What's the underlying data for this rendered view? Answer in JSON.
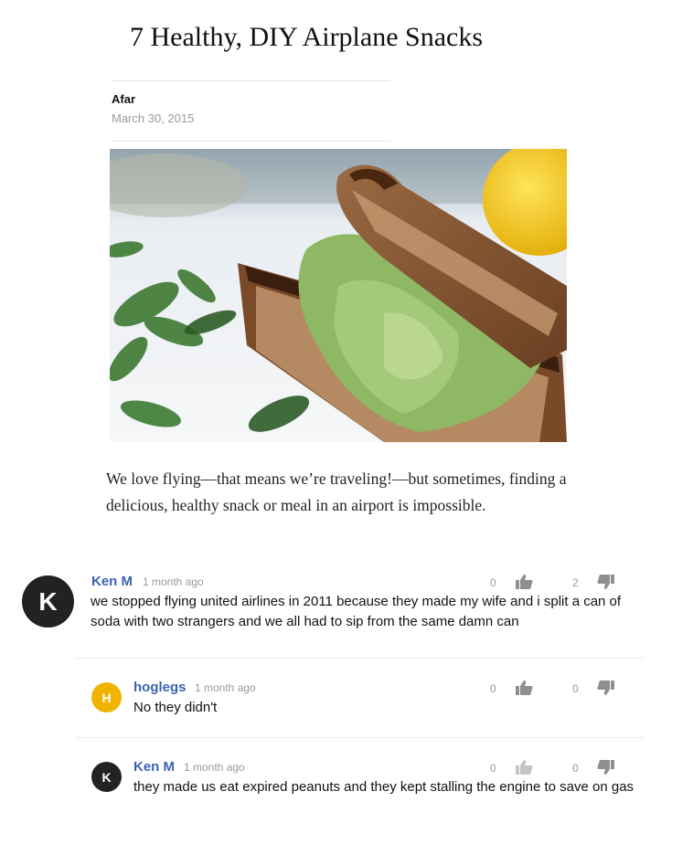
{
  "article": {
    "title": "7 Healthy, DIY Airplane Snacks",
    "author": "Afar",
    "date": "March 30, 2015",
    "intro": "We love flying—that means we’re traveling!—but sometimes, finding a delicious, healthy snack or meal in an airport is impossible."
  },
  "comments": [
    {
      "avatar_letter": "K",
      "avatar_color": "#222222",
      "name": "Ken M",
      "time": "1 month ago",
      "text": "we stopped flying united airlines in 2011 because they made my wife and i split a can of soda with two strangers and we all had to sip from the same damn can",
      "likes": "0",
      "dislikes": "2"
    },
    {
      "avatar_letter": "H",
      "avatar_color": "#f0b400",
      "name": "hoglegs",
      "time": "1 month ago",
      "text": "No they didn't",
      "likes": "0",
      "dislikes": "0"
    },
    {
      "avatar_letter": "K",
      "avatar_color": "#222222",
      "name": "Ken M",
      "time": "1 month ago",
      "text": "they made us eat expired peanuts and they kept stalling the engine to save on gas",
      "likes": "0",
      "dislikes": "0"
    }
  ],
  "icons": {
    "like": "thumbs-up-icon",
    "dislike": "thumbs-down-icon"
  }
}
